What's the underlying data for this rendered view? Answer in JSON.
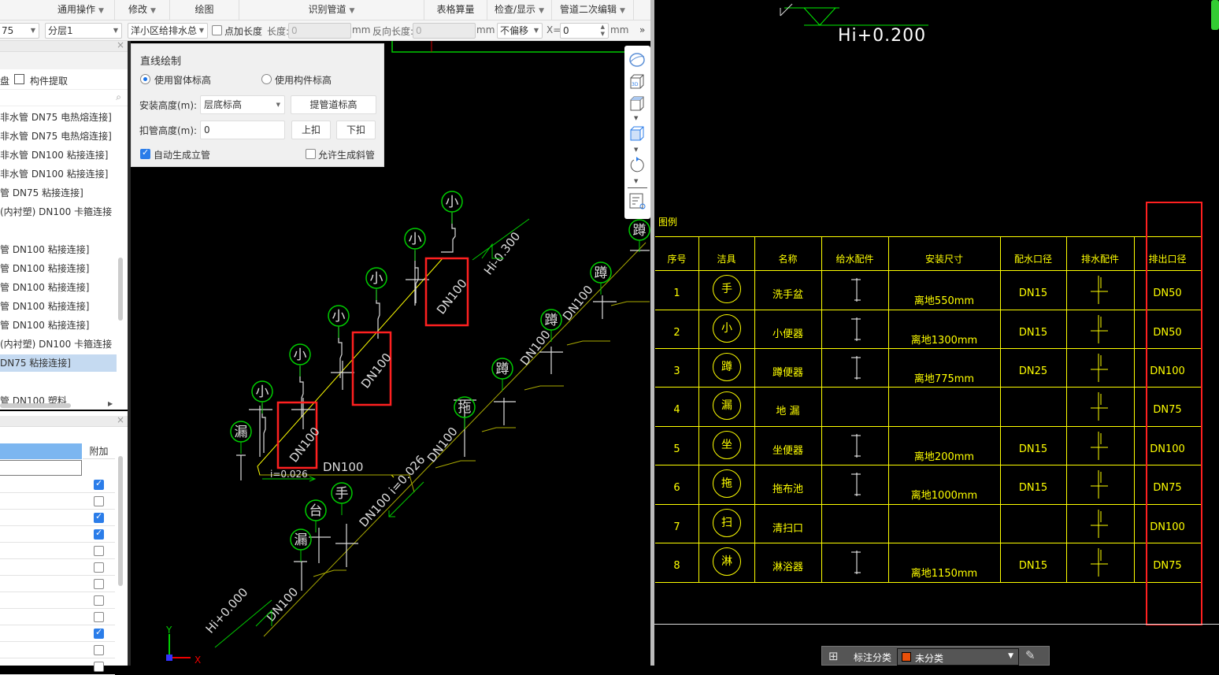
{
  "menubar": {
    "items": [
      {
        "label": "通用操作",
        "arrow": true
      },
      {
        "label": "修改",
        "arrow": true
      },
      {
        "label": "绘图",
        "arrow": false
      },
      {
        "label": "识别管道",
        "arrow": true
      },
      {
        "label": "表格算量",
        "arrow": false
      },
      {
        "label": "检查/显示",
        "arrow": true
      },
      {
        "label": "管道二次编辑",
        "arrow": true
      }
    ]
  },
  "optbar": {
    "combo1": "75",
    "floor": "分层1",
    "system": "洋小区给排水总",
    "point_length_label": "点加长度",
    "length_label": "长度:",
    "length_value": "0",
    "mm1": "mm",
    "reverse_label": "反向长度:",
    "reverse_value": "0",
    "mm2": "mm",
    "offset": "不偏移",
    "x_label": "X=",
    "x_value": "0",
    "mm3": "mm",
    "more": "»"
  },
  "leftpanel": {
    "toolbar": {
      "disk_label": "盘",
      "extract_label": "构件提取"
    },
    "items": [
      {
        "label": "非水管 DN75 电热熔连接]",
        "selected": false
      },
      {
        "label": "非水管 DN75 电热熔连接]",
        "selected": false
      },
      {
        "label": "非水管 DN100 粘接连接]",
        "selected": false
      },
      {
        "label": "非水管 DN100 粘接连接]",
        "selected": false
      },
      {
        "label": "管 DN75 粘接连接]",
        "selected": false
      },
      {
        "label": "(内衬塑)  DN100 卡箍连接",
        "selected": false
      },
      {
        "label": "",
        "selected": false
      },
      {
        "label": "管 DN100 粘接连接]",
        "selected": false
      },
      {
        "label": "管 DN100 粘接连接]",
        "selected": false
      },
      {
        "label": "管 DN100 粘接连接]",
        "selected": false
      },
      {
        "label": "管 DN100 粘接连接]",
        "selected": false
      },
      {
        "label": "管 DN100 粘接连接]",
        "selected": false
      },
      {
        "label": "(内衬塑)  DN100 卡箍连接",
        "selected": false
      },
      {
        "label": "DN75 粘接连接]",
        "selected": true
      },
      {
        "label": "",
        "selected": false
      },
      {
        "label": "管 DN100 塑料",
        "selected": false
      }
    ]
  },
  "proppanel": {
    "extra_header": "附加",
    "checks": [
      true,
      false,
      true,
      true,
      false,
      false,
      false,
      false,
      false,
      true,
      false,
      false
    ]
  },
  "dialog": {
    "title": "直线绘制",
    "radio1": "使用窗体标高",
    "radio2": "使用构件标高",
    "install_label": "安装高度(m):",
    "install_value": "层底标高",
    "lift_button": "提管道标高",
    "offset_label": "扣管高度(m):",
    "offset_value": "0",
    "up_button": "上扣",
    "down_button": "下扣",
    "auto_riser": "自动生成立管",
    "allow_slope": "允许生成斜管"
  },
  "drawing": {
    "fixtures": [
      "小",
      "小",
      "小",
      "小",
      "小",
      "小",
      "漏",
      "台",
      "手",
      "漏",
      "拖",
      "蹲",
      "蹲",
      "蹲",
      "蹲"
    ],
    "labels": {
      "dn_box1": "DN100",
      "dn_box2": "DN100",
      "dn_box3": "DN100",
      "dn_h": "DN100",
      "slope1": "i=0.026",
      "elev1": "Hi-0.300",
      "dn_r1": "DN100",
      "dn_r2": "DN100",
      "dn_r3": "DN100",
      "dn_r4": "DN100 i=0.026",
      "elev2": "Hi+0.000",
      "dn_r5": "DN100",
      "axis_y": "Y",
      "axis_x": "X"
    }
  },
  "right": {
    "elev_top": "Hi+0.200",
    "legend_title": "图例",
    "headers": [
      "序号",
      "洁具",
      "名称",
      "给水配件",
      "安装尺寸",
      "配水口径",
      "排水配件",
      "排出口径"
    ],
    "rows": [
      {
        "no": "1",
        "sym": "手",
        "name": "洗手盆",
        "size": "离地550mm",
        "supply": "DN15",
        "outlet": "DN50"
      },
      {
        "no": "2",
        "sym": "小",
        "name": "小便器",
        "size": "离地1300mm",
        "supply": "DN15",
        "outlet": "DN50"
      },
      {
        "no": "3",
        "sym": "蹲",
        "name": "蹲便器",
        "size": "离地775mm",
        "supply": "DN25",
        "outlet": "DN100"
      },
      {
        "no": "4",
        "sym": "漏",
        "name": "地 漏",
        "size": "",
        "supply": "",
        "outlet": "DN75"
      },
      {
        "no": "5",
        "sym": "坐",
        "name": "坐便器",
        "size": "离地200mm",
        "supply": "DN15",
        "outlet": "DN100"
      },
      {
        "no": "6",
        "sym": "拖",
        "name": "拖布池",
        "size": "离地1000mm",
        "supply": "DN15",
        "outlet": "DN75"
      },
      {
        "no": "7",
        "sym": "扫",
        "name": "清扫口",
        "size": "",
        "supply": "",
        "outlet": "DN100"
      },
      {
        "no": "8",
        "sym": "淋",
        "name": "淋浴器",
        "size": "离地1150mm",
        "supply": "DN15",
        "outlet": "DN75"
      }
    ]
  },
  "annot": {
    "label": "标注分类",
    "value": "未分类",
    "swatch": "#e8500a"
  },
  "colors": {
    "highlight": "#ff2020",
    "pipe": "#ffff00",
    "symbol": "#00e000"
  }
}
